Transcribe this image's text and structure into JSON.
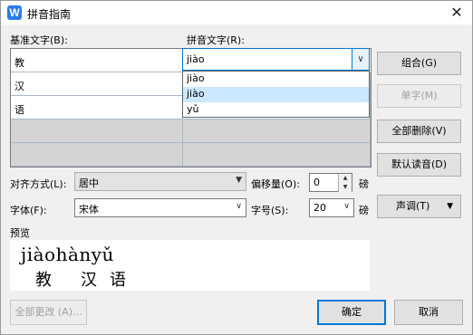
{
  "window": {
    "title": "拼音指南",
    "close_glyph": "✕",
    "app_icon_letter": "W"
  },
  "labels": {
    "base_text": "基准文字(B):",
    "pinyin_text": "拼音文字(R):",
    "align": "对齐方式(L):",
    "offset": "偏移量(O):",
    "font": "字体(F):",
    "size": "字号(S):",
    "pound1": "磅",
    "pound2": "磅",
    "preview": "预览"
  },
  "grid": {
    "rows": [
      {
        "base": "教",
        "pinyin": "jiào"
      },
      {
        "base": "汉",
        "pinyin": ""
      },
      {
        "base": "语",
        "pinyin": ""
      }
    ]
  },
  "pinyin_combo": {
    "value": "jiào",
    "options": [
      "jiào",
      "jiào",
      "yǔ"
    ],
    "selected_index": 1
  },
  "buttons": {
    "combine": "组合(G)",
    "single": "单字(M)",
    "delete_all": "全部删除(V)",
    "default_reading": "默认读音(D)",
    "tone": "声调(T)",
    "apply_all": "全部更改 (A)...",
    "ok": "确定",
    "cancel": "取消"
  },
  "align_select": {
    "value": "居中"
  },
  "offset_spin": {
    "value": "0"
  },
  "font_select": {
    "value": "宋体"
  },
  "size_select": {
    "value": "20"
  },
  "preview": {
    "pinyin": "jiàohànyǔ",
    "chars": [
      "教",
      "汉",
      "语"
    ]
  }
}
